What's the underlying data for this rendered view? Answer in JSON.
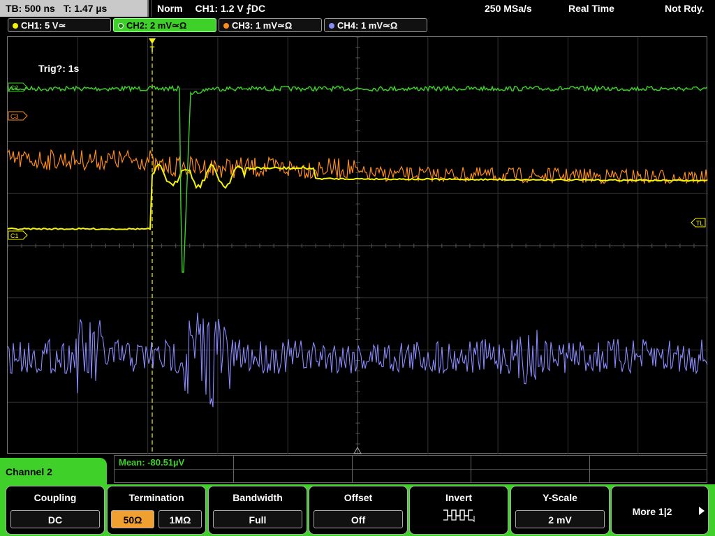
{
  "status": {
    "timebase": "TB: 500 ns",
    "trigger_time": "T: 1.47 µs",
    "mode": "Norm",
    "trigger": "CH1: 1.2 V ⨍DC",
    "sample_rate": "250 MSa/s",
    "acq": "Real Time",
    "ready": "Not Rdy."
  },
  "channels": [
    {
      "label": "CH1: 5 V≃",
      "color": "#f5f500"
    },
    {
      "label": "CH2: 2 mV≃Ω",
      "color": "#3fd12a"
    },
    {
      "label": "CH3: 1 mV≃Ω",
      "color": "#ff8c1a"
    },
    {
      "label": "CH4: 1 mV≃Ω",
      "color": "#8a8aff"
    }
  ],
  "screen": {
    "trig_text": "Trig?: 1s",
    "markers": {
      "c2": "C2",
      "c3": "C3",
      "c1": "C1",
      "tl": "TL",
      "trig": "T"
    }
  },
  "bottom": {
    "channel_name": "Channel 2",
    "measurement": "Mean: -80.51µV"
  },
  "softkeys": {
    "coupling": {
      "title": "Coupling",
      "value": "DC"
    },
    "termination": {
      "title": "Termination",
      "opt1": "50Ω",
      "opt2": "1MΩ"
    },
    "bandwidth": {
      "title": "Bandwidth",
      "value": "Full"
    },
    "offset": {
      "title": "Offset",
      "value": "Off"
    },
    "invert": {
      "title": "Invert"
    },
    "yscale": {
      "title": "Y-Scale",
      "value": "2 mV"
    },
    "more": {
      "title": "More 1|2"
    }
  }
}
